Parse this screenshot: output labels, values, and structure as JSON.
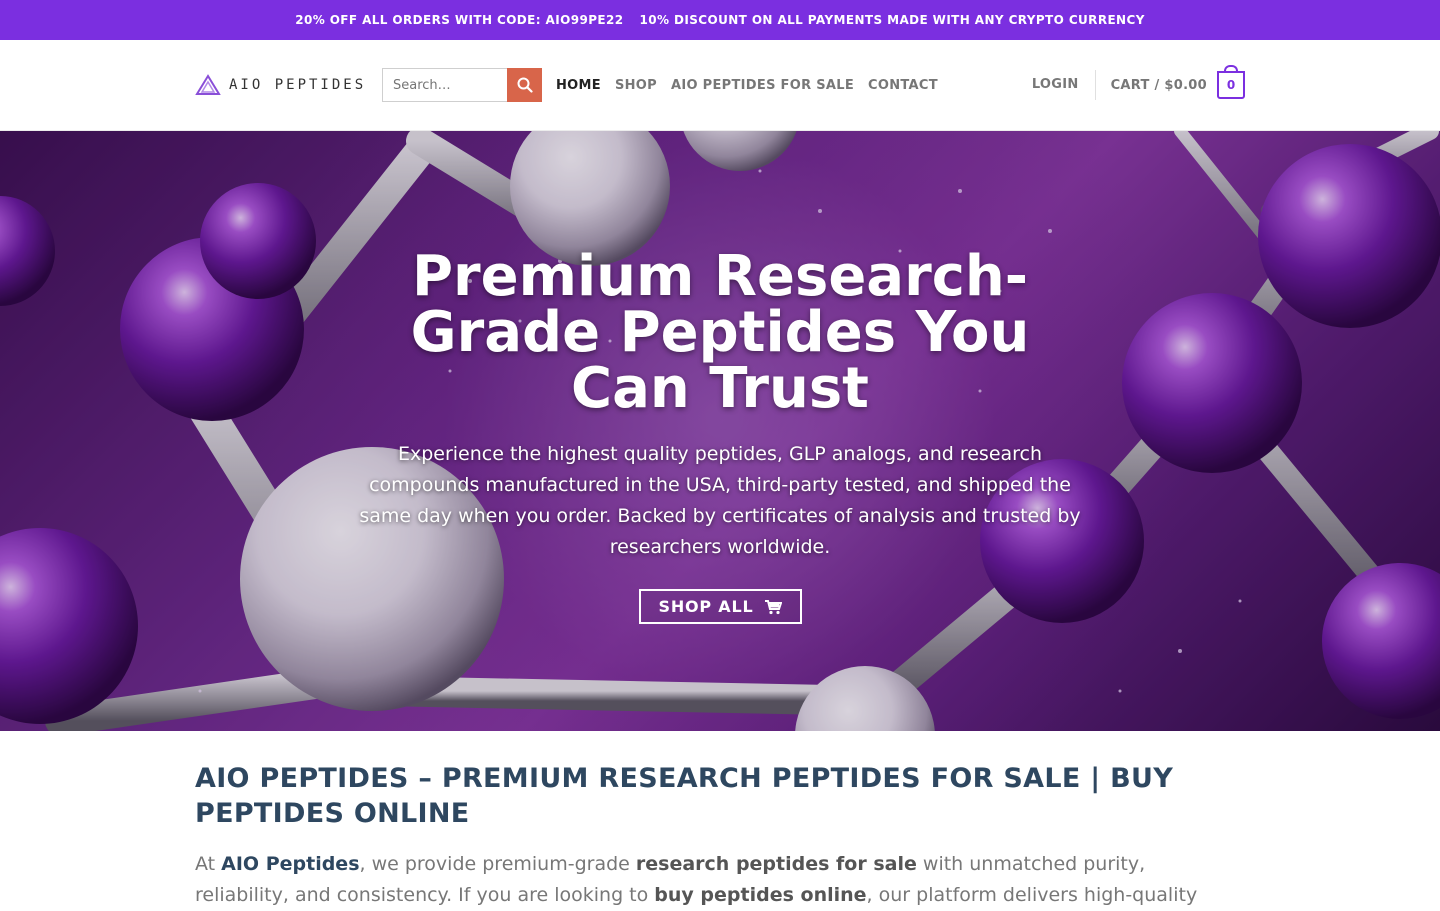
{
  "promo_bar": {
    "offer_1": "20% OFF ALL ORDERS WITH CODE: AIO99PE22",
    "offer_2": "10% DISCOUNT ON ALL PAYMENTS MADE WITH ANY CRYPTO CURRENCY"
  },
  "header": {
    "logo_text": "AIO PEPTIDES",
    "search": {
      "placeholder": "Search…",
      "icon": "search-icon"
    },
    "nav": [
      {
        "label": "HOME",
        "active": true
      },
      {
        "label": "SHOP",
        "active": false
      },
      {
        "label": "AIO PEPTIDES FOR SALE",
        "active": false
      },
      {
        "label": "CONTACT",
        "active": false
      }
    ],
    "login_label": "LOGIN",
    "cart_label": "CART / $0.00",
    "cart_count": "0"
  },
  "hero": {
    "title": "Premium Research-Grade Peptides You Can Trust",
    "subtitle": "Experience the highest quality peptides, GLP analogs, and research compounds manufactured in the USA, third-party tested, and shipped the same day when you order. Backed by certificates of analysis and trusted by researchers worldwide.",
    "button_label": "SHOP ALL",
    "button_icon": "cart-icon"
  },
  "content": {
    "heading": "AIO PEPTIDES – PREMIUM RESEARCH PEPTIDES FOR SALE | BUY PEPTIDES ONLINE",
    "paragraph": {
      "t1": "At ",
      "b1": "AIO Peptides",
      "t2": ", we provide premium-grade ",
      "b2": "research peptides for sale",
      "t3": " with unmatched purity, reliability, and consistency. If you are looking to ",
      "b3": "buy peptides online",
      "t4": ", our platform delivers high-quality"
    }
  },
  "colors": {
    "brand_purple": "#7b2fe0",
    "search_button": "#d8654a",
    "heading": "#2e4760"
  }
}
